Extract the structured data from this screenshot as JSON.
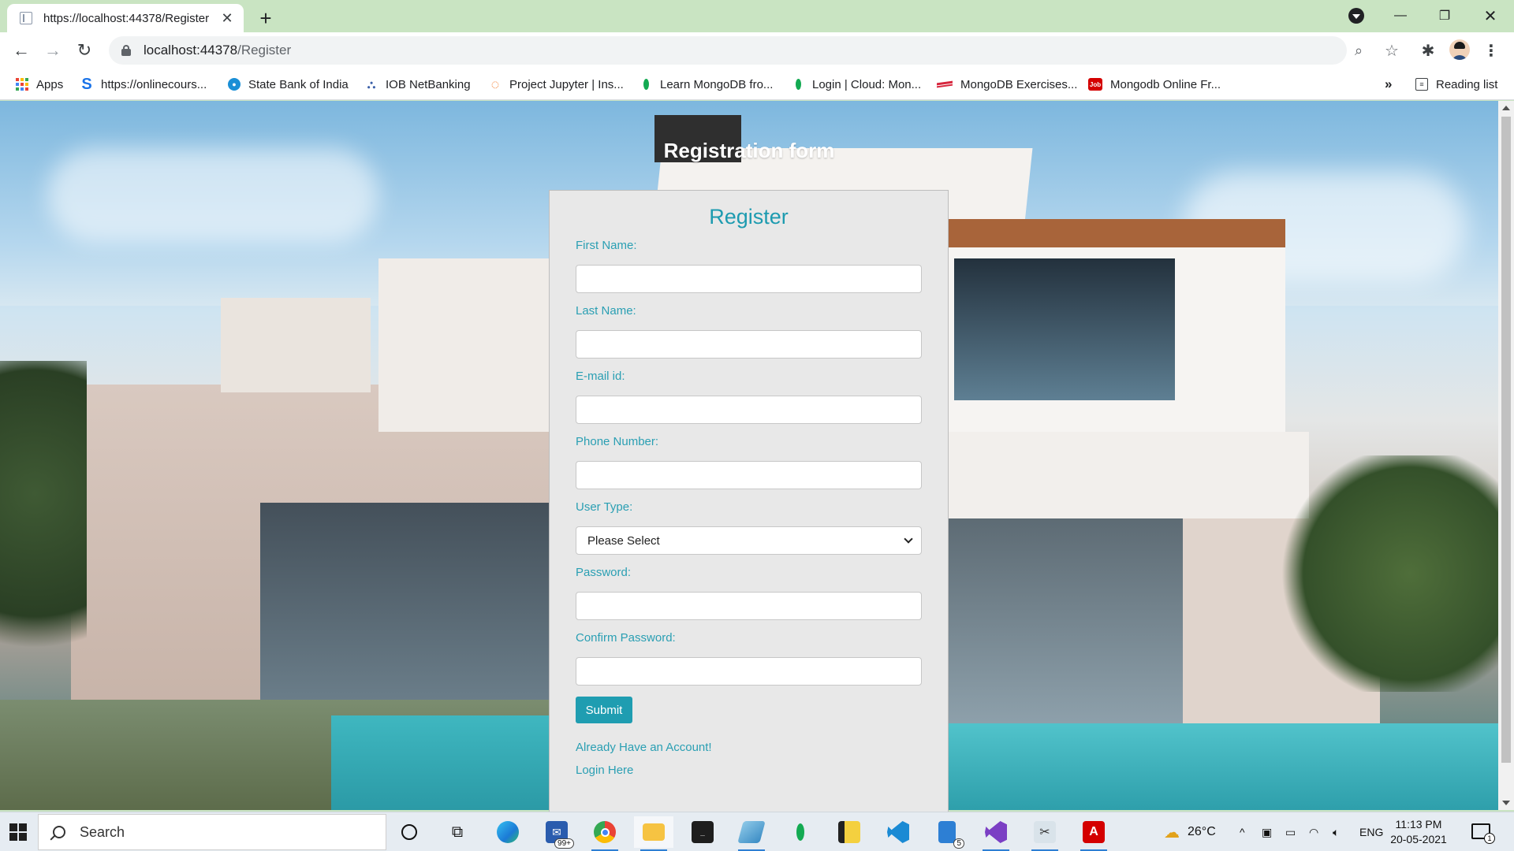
{
  "browser": {
    "tab_title": "https://localhost:44378/Register",
    "url_host": "localhost:44378",
    "url_path": "/Register"
  },
  "bookmarks": [
    {
      "label": "Apps",
      "icon": "apps-grid-icon"
    },
    {
      "label": "https://onlinecours...",
      "icon": "s-logo-icon"
    },
    {
      "label": "State Bank of India",
      "icon": "sbi-logo-icon"
    },
    {
      "label": "IOB NetBanking",
      "icon": "iob-logo-icon"
    },
    {
      "label": "Project Jupyter | Ins...",
      "icon": "jupyter-logo-icon"
    },
    {
      "label": "Learn MongoDB fro...",
      "icon": "mongodb-leaf-icon"
    },
    {
      "label": "Login | Cloud: Mon...",
      "icon": "mongodb-leaf-icon"
    },
    {
      "label": "MongoDB Exercises...",
      "icon": "w3resource-icon"
    },
    {
      "label": "Mongodb Online Fr...",
      "icon": "job-logo-icon"
    }
  ],
  "reading_list": "Reading list",
  "page": {
    "heading": "Registration form",
    "form": {
      "title": "Register",
      "first_name_label": "First Name:",
      "last_name_label": "Last Name:",
      "email_label": "E-mail id:",
      "phone_label": "Phone Number:",
      "user_type_label": "User Type:",
      "user_type_selected": "Please Select",
      "password_label": "Password:",
      "confirm_password_label": "Confirm Password:",
      "submit_label": "Submit",
      "already_account": "Already Have an Account!",
      "login_here": "Login Here"
    }
  },
  "taskbar": {
    "search_text": "Search",
    "mail_badge": "99+",
    "files_badge": "5",
    "weather": "26°C",
    "language": "ENG",
    "time": "11:13 PM",
    "date": "20-05-2021",
    "notifications": "1"
  },
  "colors": {
    "accent": "#1f9db1",
    "tabstrip": "#c9e4c2"
  }
}
